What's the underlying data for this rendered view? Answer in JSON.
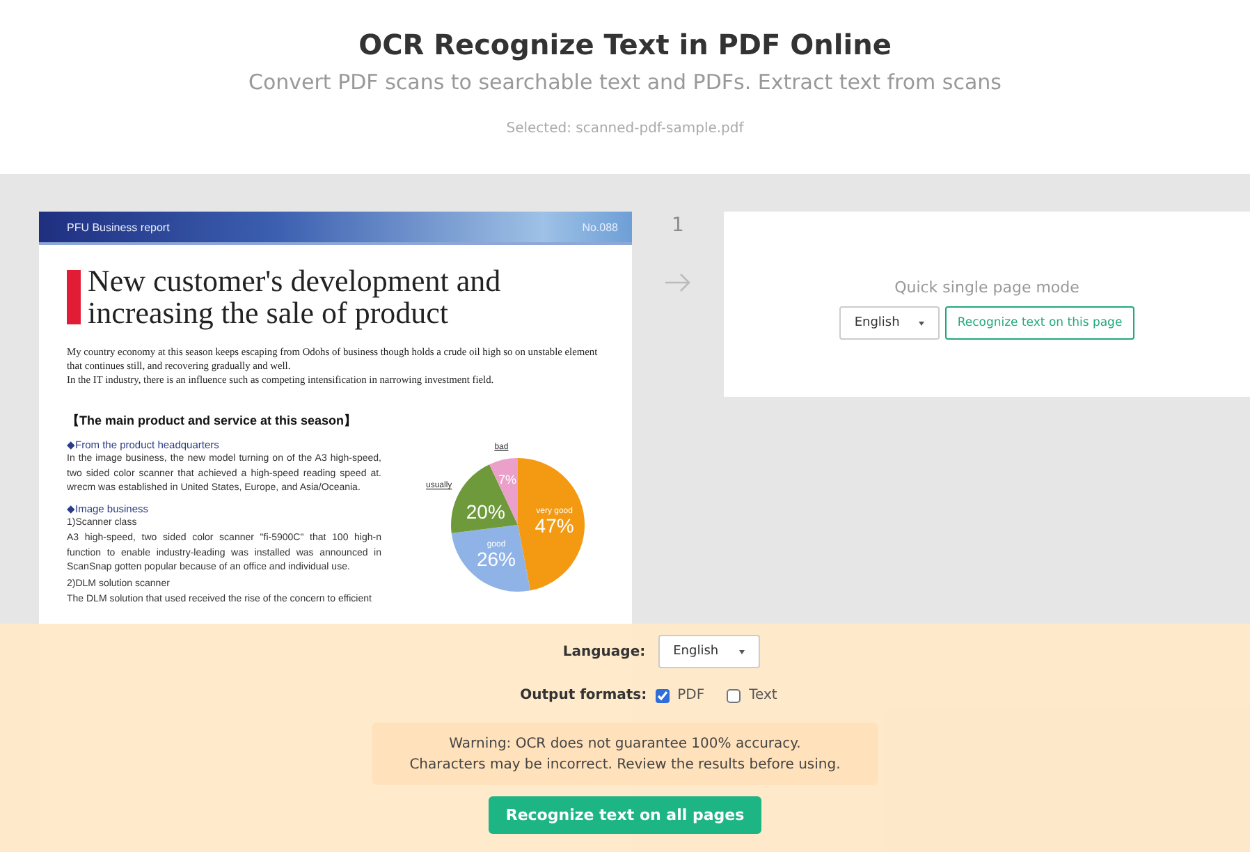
{
  "header": {
    "title": "OCR Recognize Text in PDF Online",
    "subtitle": "Convert PDF scans to searchable text and PDFs. Extract text from scans",
    "selected_file": "Selected: scanned-pdf-sample.pdf"
  },
  "pages": [
    {
      "number": "1",
      "document": {
        "band_left": "PFU Business report",
        "band_right": "No.088",
        "title": "New customer's development and increasing the sale of product",
        "intro": [
          "My country economy at this season keeps escaping from Odohs of business though holds a crude oil high so on unstable element that continues still, and recovering gradually and well.",
          "In the IT industry, there is an influence such as competing intensification in narrowing investment field."
        ],
        "section_heading": "【The main product and service at this season】",
        "blocks": [
          {
            "kind": "subheading",
            "text": "◆From the product headquarters"
          },
          {
            "kind": "paragraph",
            "text": "In the image business, the new model turning on of the A3 high-speed, two sided color scanner that achieved a high-speed reading speed at. wrecm was established in United States, Europe, and Asia/Oceania."
          },
          {
            "kind": "subheading",
            "text": "◆Image business"
          },
          {
            "kind": "paragraph",
            "text": "1)Scanner class"
          },
          {
            "kind": "paragraph",
            "text": "A3 high-speed, two sided color scanner \"fi-5900C\" that 100 high-n function to enable industry-leading was installed was announced in ScanSnap gotten popular because of an office and individual use."
          },
          {
            "kind": "paragraph",
            "text": "2)DLM solution scanner"
          },
          {
            "kind": "paragraph",
            "text": "The DLM solution that used received the rise of the concern to efficient"
          }
        ],
        "chart_data": {
          "type": "pie",
          "categories": [
            "very good",
            "good",
            "usually",
            "bad"
          ],
          "values": [
            47,
            26,
            20,
            7
          ],
          "colors": [
            "#f39a12",
            "#8fb3e6",
            "#6f9a3c",
            "#eaa0c8"
          ],
          "data_labels": true,
          "value_labels": [
            "47%",
            "26%",
            "20%",
            "7%"
          ]
        }
      },
      "quick_mode": {
        "label": "Quick single page mode",
        "language": "English",
        "button": "Recognize text on this page"
      }
    }
  ],
  "options": {
    "language_label": "Language:",
    "language": "English",
    "formats_label": "Output formats:",
    "formats": [
      {
        "label": "PDF",
        "checked": true
      },
      {
        "label": "Text",
        "checked": false
      }
    ],
    "warning": [
      "Warning: OCR does not guarantee 100% accuracy.",
      "Characters may be incorrect. Review the results before using."
    ],
    "submit": "Recognize text on all pages"
  }
}
